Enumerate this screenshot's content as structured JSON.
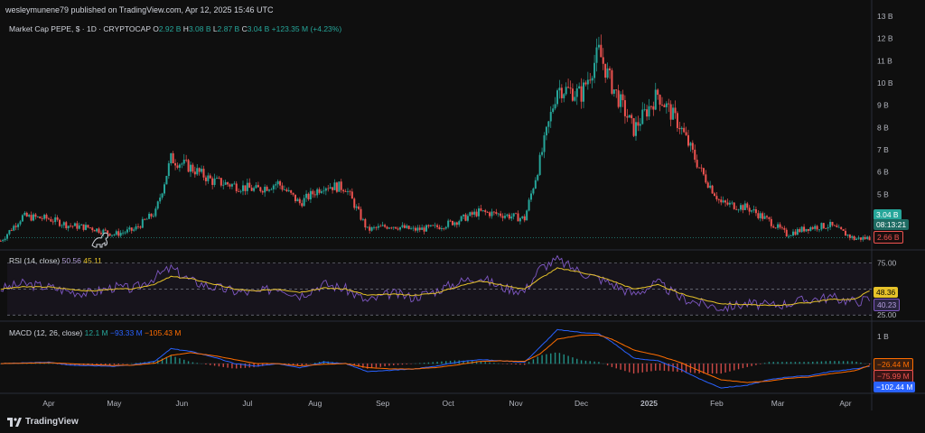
{
  "header": {
    "text": "wesleymunene79 published on TradingView.com, Apr 12, 2025 15:46 UTC"
  },
  "main_legend": {
    "symbol": "Market Cap PEPE, $ · 1D · CRYPTOCAP",
    "o_label": "O",
    "o_value": "2.92 B",
    "h_label": "H",
    "h_value": "3.08 B",
    "l_label": "L",
    "l_value": "2.87 B",
    "c_label": "C",
    "c_value": "3.04 B",
    "change": "+123.35 M (+4.23%)"
  },
  "rsi_legend": {
    "label": "RSI (14, close)",
    "v1": "50.56",
    "v2": "45.11"
  },
  "macd_legend": {
    "label": "MACD (12, 26, close)",
    "v1": "12.1 M",
    "v2": "−93.33 M",
    "v3": "−105.43 M"
  },
  "price_tags": {
    "last": "3.04 B",
    "countdown": "08:13:21",
    "low": "2.66 B"
  },
  "rsi_tags": {
    "yellow": "48.36",
    "purple": "40.23"
  },
  "macd_tags": {
    "orange": "−26.44 M",
    "red": "−75.99 M",
    "blue": "−102.44 M"
  },
  "branding": {
    "logo_text": "TradingView"
  },
  "colors": {
    "up": "#26a69a",
    "down": "#ef5350",
    "rsi": "#7e57c2",
    "rsi_ma": "#e6c229",
    "macd": "#2962ff",
    "signal": "#ff6d00",
    "bg": "#0f0f0f"
  },
  "chart_data": [
    {
      "type": "candlestick",
      "title": "Market Cap PEPE, $ · 1D · CRYPTOCAP",
      "y_axis_labels": [
        "4 B",
        "5 B",
        "6 B",
        "7 B",
        "8 B",
        "9 B",
        "10 B",
        "11 B",
        "12 B",
        "13 B"
      ],
      "x_axis_labels": [
        "Apr",
        "May",
        "Jun",
        "Jul",
        "Aug",
        "Sep",
        "Oct",
        "Nov",
        "Dec",
        "2025",
        "Feb",
        "Mar",
        "Apr"
      ],
      "ylim": [
        2.5,
        13
      ],
      "x": [
        "2024-03-10",
        "2024-03-20",
        "2024-04-01",
        "2024-04-10",
        "2024-04-20",
        "2024-05-01",
        "2024-05-10",
        "2024-05-20",
        "2024-05-27",
        "2024-06-05",
        "2024-06-15",
        "2024-06-25",
        "2024-07-05",
        "2024-07-15",
        "2024-07-25",
        "2024-08-05",
        "2024-08-15",
        "2024-08-25",
        "2024-09-05",
        "2024-09-15",
        "2024-09-25",
        "2024-10-05",
        "2024-10-15",
        "2024-10-25",
        "2024-11-05",
        "2024-11-12",
        "2024-11-20",
        "2024-12-01",
        "2024-12-09",
        "2024-12-15",
        "2024-12-25",
        "2025-01-05",
        "2025-01-15",
        "2025-01-25",
        "2025-02-03",
        "2025-02-15",
        "2025-02-25",
        "2025-03-05",
        "2025-03-15",
        "2025-03-25",
        "2025-04-05",
        "2025-04-12"
      ],
      "close": [
        2.9,
        4.0,
        3.9,
        3.6,
        3.5,
        3.2,
        3.4,
        4.2,
        6.6,
        6.2,
        5.6,
        5.4,
        5.2,
        5.5,
        4.6,
        5.4,
        5.3,
        3.4,
        3.6,
        3.4,
        3.5,
        3.8,
        4.2,
        4.1,
        3.9,
        6.5,
        9.8,
        9.5,
        11.4,
        9.9,
        7.9,
        9.5,
        8.1,
        6.0,
        4.6,
        4.4,
        3.8,
        3.2,
        3.5,
        3.6,
        3.0,
        3.04
      ],
      "last_value": 3.04,
      "last_low": 2.66
    },
    {
      "type": "line",
      "title": "RSI (14, close)",
      "y_axis_labels": [
        "25.00",
        "75.00"
      ],
      "ylim": [
        20,
        85
      ],
      "series": [
        {
          "name": "RSI",
          "values": [
            50,
            55,
            52,
            48,
            46,
            52,
            50,
            62,
            70,
            58,
            52,
            48,
            46,
            52,
            44,
            55,
            50,
            38,
            46,
            42,
            48,
            56,
            62,
            52,
            48,
            70,
            78,
            66,
            60,
            55,
            45,
            56,
            42,
            36,
            32,
            36,
            34,
            36,
            40,
            42,
            38,
            40.23
          ]
        },
        {
          "name": "RSI-based MA",
          "values": [
            50,
            52,
            52,
            50,
            48,
            50,
            50,
            55,
            62,
            60,
            55,
            50,
            48,
            50,
            47,
            51,
            50,
            44,
            45,
            44,
            46,
            52,
            58,
            54,
            50,
            60,
            70,
            66,
            62,
            58,
            50,
            54,
            46,
            40,
            36,
            35,
            34,
            35,
            37,
            40,
            40,
            48.36
          ]
        }
      ],
      "hlines": [
        75,
        50,
        25
      ]
    },
    {
      "type": "line",
      "title": "MACD (12, 26, close)",
      "y_axis_labels": [
        "1 B"
      ],
      "series": [
        {
          "name": "MACD",
          "values": [
            0,
            0.02,
            0.05,
            -0.05,
            -0.08,
            -0.1,
            -0.05,
            0.1,
            0.55,
            0.45,
            0.25,
            0.0,
            -0.1,
            0.0,
            -0.15,
            0.05,
            0.0,
            -0.3,
            -0.25,
            -0.2,
            -0.1,
            0.05,
            0.15,
            0.1,
            0.05,
            0.6,
            1.25,
            1.15,
            1.1,
            0.8,
            0.2,
            0.1,
            -0.2,
            -0.6,
            -0.9,
            -0.8,
            -0.6,
            -0.5,
            -0.45,
            -0.3,
            -0.2,
            -0.102
          ]
        },
        {
          "name": "Signal",
          "values": [
            0,
            0.01,
            0.03,
            0.0,
            -0.04,
            -0.07,
            -0.06,
            0.02,
            0.3,
            0.4,
            0.3,
            0.15,
            0.0,
            0.0,
            -0.08,
            -0.03,
            0.0,
            -0.15,
            -0.2,
            -0.2,
            -0.15,
            -0.05,
            0.08,
            0.1,
            0.08,
            0.35,
            0.9,
            1.05,
            1.05,
            0.9,
            0.5,
            0.3,
            0.05,
            -0.3,
            -0.6,
            -0.7,
            -0.65,
            -0.55,
            -0.5,
            -0.38,
            -0.27,
            -0.076
          ]
        }
      ],
      "histogram_last": -0.026
    }
  ]
}
